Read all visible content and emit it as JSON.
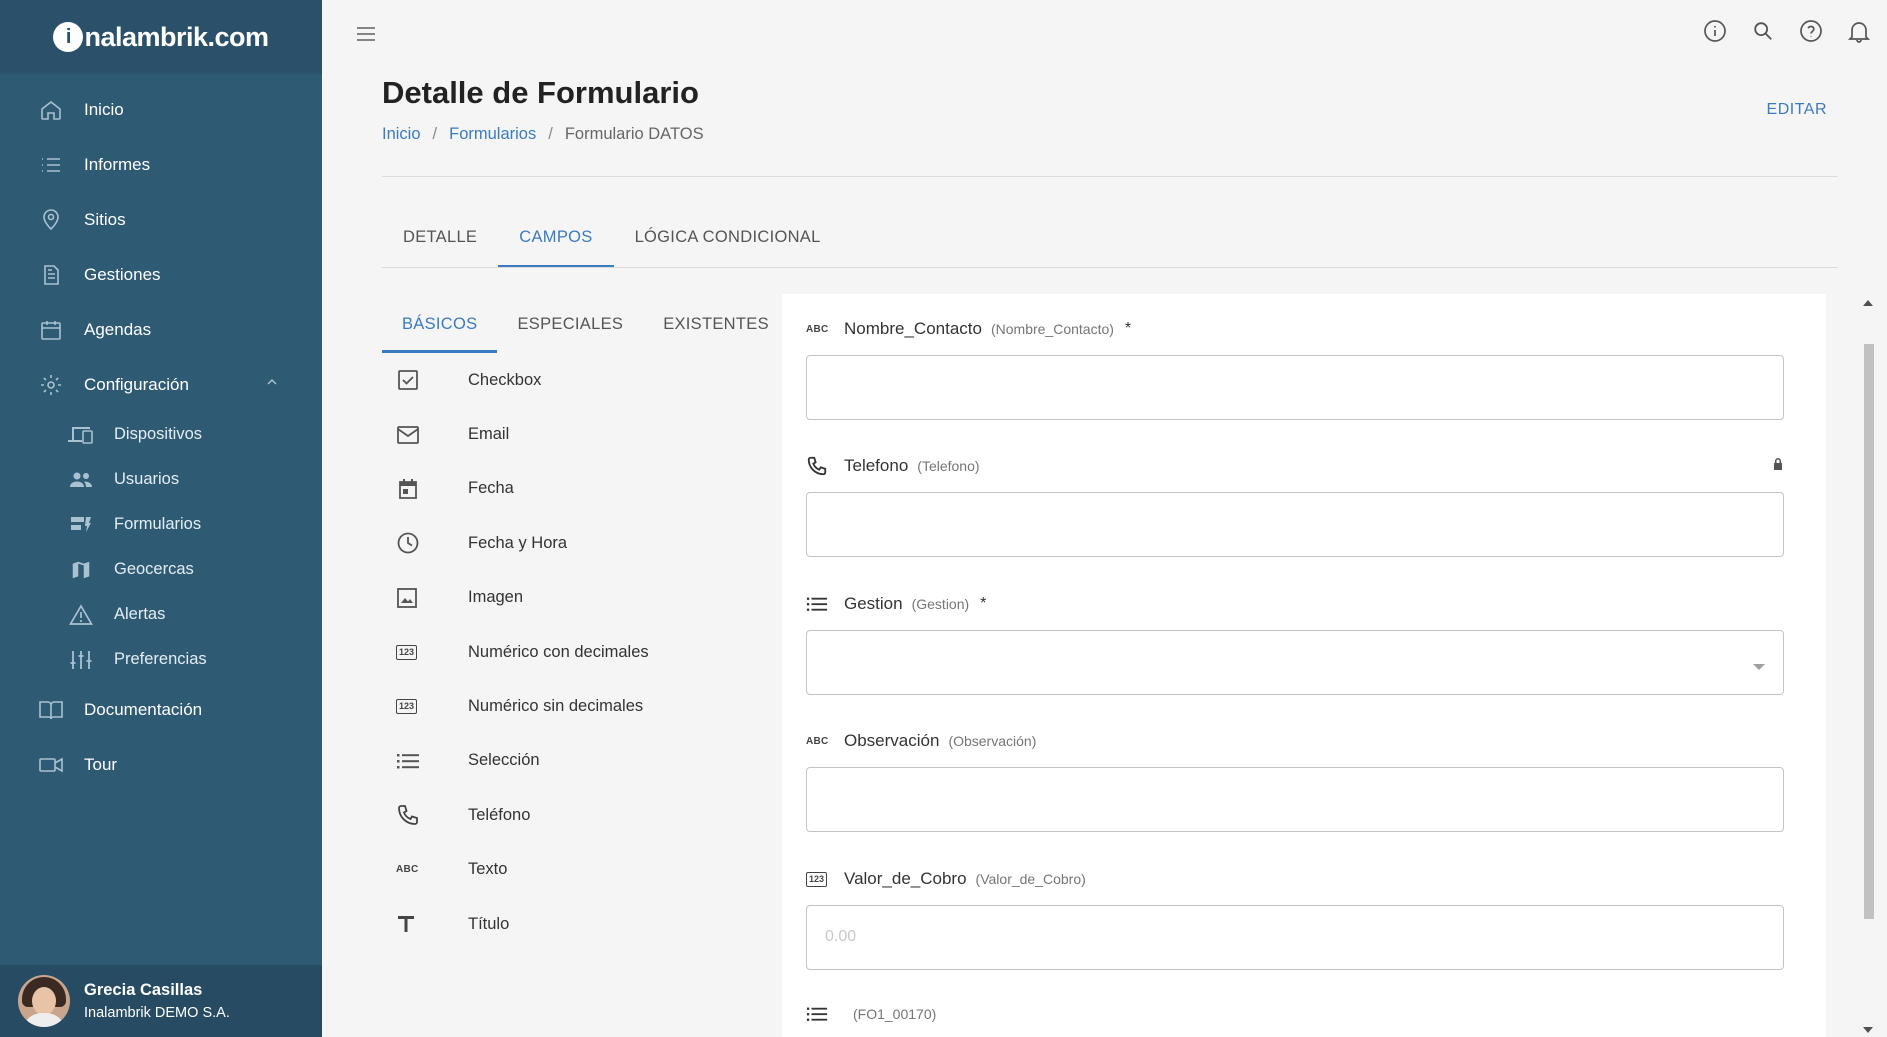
{
  "brand": {
    "logo_text": "nalambrik.com",
    "logo_ball": "i"
  },
  "sidebar": {
    "items": [
      {
        "label": "Inicio",
        "icon": "home-icon"
      },
      {
        "label": "Informes",
        "icon": "list-icon"
      },
      {
        "label": "Sitios",
        "icon": "location-pin-icon"
      },
      {
        "label": "Gestiones",
        "icon": "document-icon"
      },
      {
        "label": "Agendas",
        "icon": "calendar-icon"
      },
      {
        "label": "Configuración",
        "icon": "gear-icon",
        "expanded": true
      }
    ],
    "subitems": [
      {
        "label": "Dispositivos",
        "icon": "devices-icon"
      },
      {
        "label": "Usuarios",
        "icon": "people-icon"
      },
      {
        "label": "Formularios",
        "icon": "dynamic-form-icon"
      },
      {
        "label": "Geocercas",
        "icon": "map-icon"
      },
      {
        "label": "Alertas",
        "icon": "warning-icon"
      },
      {
        "label": "Preferencias",
        "icon": "tune-icon"
      }
    ],
    "bottom_items": [
      {
        "label": "Documentación",
        "icon": "book-icon"
      },
      {
        "label": "Tour",
        "icon": "video-icon"
      }
    ],
    "user": {
      "name": "Grecia Casillas",
      "company": "Inalambrik DEMO S.A."
    }
  },
  "header": {
    "title": "Detalle de Formulario",
    "breadcrumb": [
      "Inicio",
      "Formularios",
      "Formulario DATOS"
    ],
    "edit_label": "EDITAR"
  },
  "tabs": [
    "DETALLE",
    "CAMPOS",
    "LÓGICA CONDICIONAL"
  ],
  "active_tab": "CAMPOS",
  "subtabs": [
    "BÁSICOS",
    "ESPECIALES",
    "EXISTENTES"
  ],
  "active_subtab": "BÁSICOS",
  "field_types": [
    {
      "label": "Checkbox",
      "icon": "checkbox-icon"
    },
    {
      "label": "Email",
      "icon": "email-icon"
    },
    {
      "label": "Fecha",
      "icon": "calendar-icon"
    },
    {
      "label": "Fecha y Hora",
      "icon": "clock-icon"
    },
    {
      "label": "Imagen",
      "icon": "image-icon"
    },
    {
      "label": "Numérico con decimales",
      "icon": "numeric-icon"
    },
    {
      "label": "Numérico sin decimales",
      "icon": "numeric-icon"
    },
    {
      "label": "Selección",
      "icon": "list-icon"
    },
    {
      "label": "Teléfono",
      "icon": "phone-icon"
    },
    {
      "label": "Texto",
      "icon": "abc-icon"
    },
    {
      "label": "Título",
      "icon": "title-icon"
    }
  ],
  "abc_text": "ABC",
  "num_text": "123",
  "form_fields": [
    {
      "name": "Nombre_Contacto",
      "id": "(Nombre_Contacto)",
      "required": "*",
      "icon": "abc-icon",
      "placeholder": ""
    },
    {
      "name": "Telefono",
      "id": "(Telefono)",
      "required": "",
      "icon": "phone-icon",
      "locked": true,
      "placeholder": ""
    },
    {
      "name": "Gestion",
      "id": "(Gestion)",
      "required": "*",
      "icon": "list-icon",
      "dropdown": true,
      "placeholder": ""
    },
    {
      "name": "Observación",
      "id": "(Observación)",
      "required": "",
      "icon": "abc-icon",
      "placeholder": ""
    },
    {
      "name": "Valor_de_Cobro",
      "id": "(Valor_de_Cobro)",
      "required": "",
      "icon": "numeric-icon",
      "placeholder": "0.00"
    },
    {
      "name": "",
      "id": "(FO1_00170)",
      "required": "",
      "icon": "list-icon",
      "placeholder": ""
    }
  ]
}
